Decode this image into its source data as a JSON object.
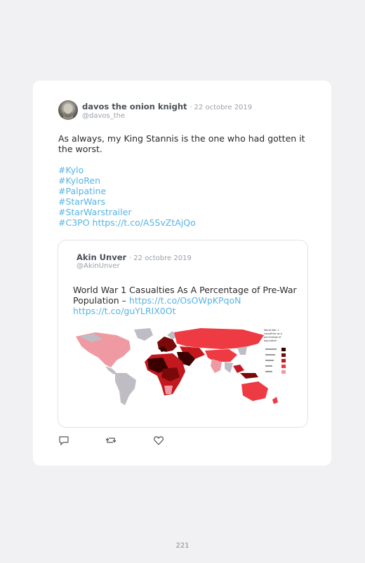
{
  "tweet": {
    "author_name": "davos the onion knight",
    "date": "· 22 octobre 2019",
    "handle": "@davos_the",
    "text": "As always, my King Stannis is the one who had gotten it the worst.",
    "hashtags": [
      "#Kylo",
      "#KyloRen",
      "#Palpatine",
      "#StarWars",
      "#StarWarstrailer",
      "#C3PO"
    ],
    "link": "https://t.co/A5SvZtAjQo"
  },
  "quoted": {
    "author_name": "Akin Unver",
    "date": "· 22 octobre 2019",
    "handle": "@AkinUnver",
    "text": "World War 1 Casualties As A Percentage of Pre-War Population –",
    "link1": "https://t.co/OsOWpKPqoN",
    "link2": "https://t.co/guYLRIX0Ot"
  },
  "actions": {
    "reply_icon": "reply-icon",
    "retweet_icon": "retweet-icon",
    "like_icon": "heart-icon"
  },
  "colors": {
    "link": "#55b4e6",
    "map_darkest": "#3a0000",
    "map_dark": "#7a0a0a",
    "map_mid": "#c2181e",
    "map_light": "#ee3a42",
    "map_pale": "#ef9aa3",
    "map_none": "#c0bcc4"
  },
  "page_number": "221"
}
